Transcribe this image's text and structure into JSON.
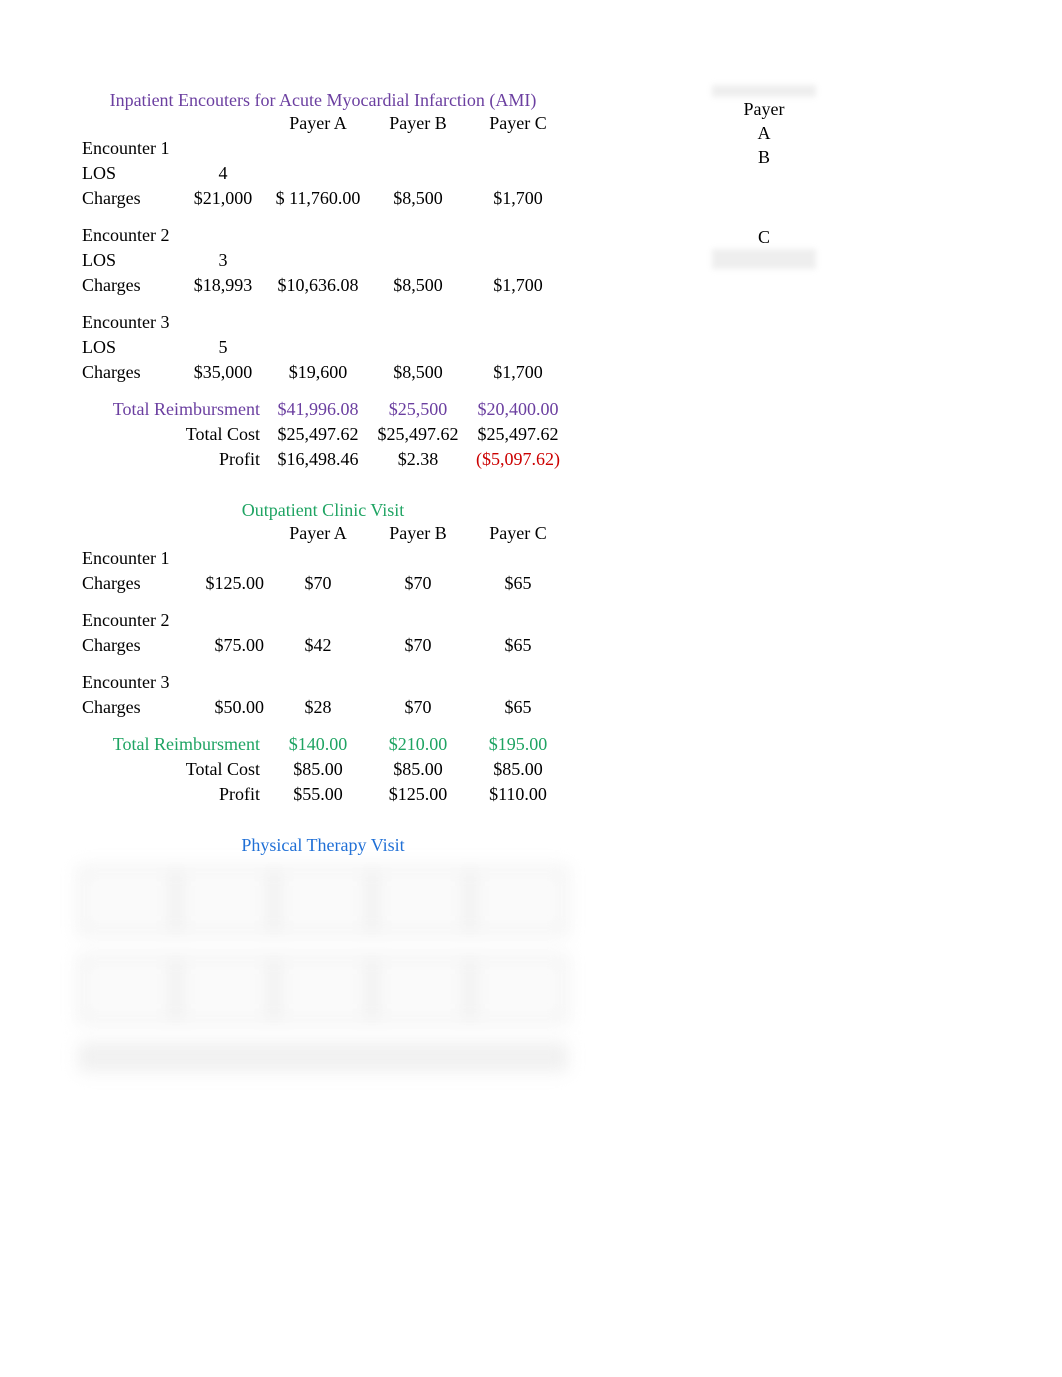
{
  "inpatient": {
    "title": "Inpatient Encouters for Acute Myocardial Infarction (AMI)",
    "headers": {
      "a": "Payer A",
      "b": "Payer B",
      "c": "Payer C"
    },
    "encounters": [
      {
        "name": "Encounter 1",
        "los_label": "LOS",
        "los": "4",
        "charges_label": "Charges",
        "charges": "$21,000",
        "a": "$  11,760.00",
        "b": "$8,500",
        "c": "$1,700"
      },
      {
        "name": "Encounter 2",
        "los_label": "LOS",
        "los": "3",
        "charges_label": "Charges",
        "charges": "$18,993",
        "a": "$10,636.08",
        "b": "$8,500",
        "c": "$1,700"
      },
      {
        "name": "Encounter 3",
        "los_label": "LOS",
        "los": "5",
        "charges_label": "Charges",
        "charges": "$35,000",
        "a": "$19,600",
        "b": "$8,500",
        "c": "$1,700"
      }
    ],
    "totals": {
      "reimb_label": "Total Reimbursment",
      "reimb": {
        "a": "$41,996.08",
        "b": "$25,500",
        "c": "$20,400.00"
      },
      "cost_label": "Total Cost",
      "cost": {
        "a": "$25,497.62",
        "b": "$25,497.62",
        "c": "$25,497.62"
      },
      "profit_label": "Profit",
      "profit": {
        "a": "$16,498.46",
        "b": "$2.38",
        "c": "($5,097.62)"
      }
    }
  },
  "outpatient": {
    "title": "Outpatient Clinic Visit",
    "headers": {
      "a": "Payer A",
      "b": "Payer B",
      "c": "Payer C"
    },
    "encounters": [
      {
        "name": "Encounter 1",
        "charges_label": "Charges",
        "charges": "$125.00",
        "a": "$70",
        "b": "$70",
        "c": "$65"
      },
      {
        "name": "Encounter 2",
        "charges_label": "Charges",
        "charges": "$75.00",
        "a": "$42",
        "b": "$70",
        "c": "$65"
      },
      {
        "name": "Encounter 3",
        "charges_label": "Charges",
        "charges": "$50.00",
        "a": "$28",
        "b": "$70",
        "c": "$65"
      }
    ],
    "totals": {
      "reimb_label": "Total Reimbursment",
      "reimb": {
        "a": "$140.00",
        "b": "$210.00",
        "c": "$195.00"
      },
      "cost_label": "Total Cost",
      "cost": {
        "a": "$85.00",
        "b": "$85.00",
        "c": "$85.00"
      },
      "profit_label": "Profit",
      "profit": {
        "a": "$55.00",
        "b": "$125.00",
        "c": "$110.00"
      }
    }
  },
  "pt": {
    "title": "Physical Therapy Visit"
  },
  "side": {
    "payer": "Payer",
    "a": "A",
    "b": "B",
    "c": "C"
  }
}
